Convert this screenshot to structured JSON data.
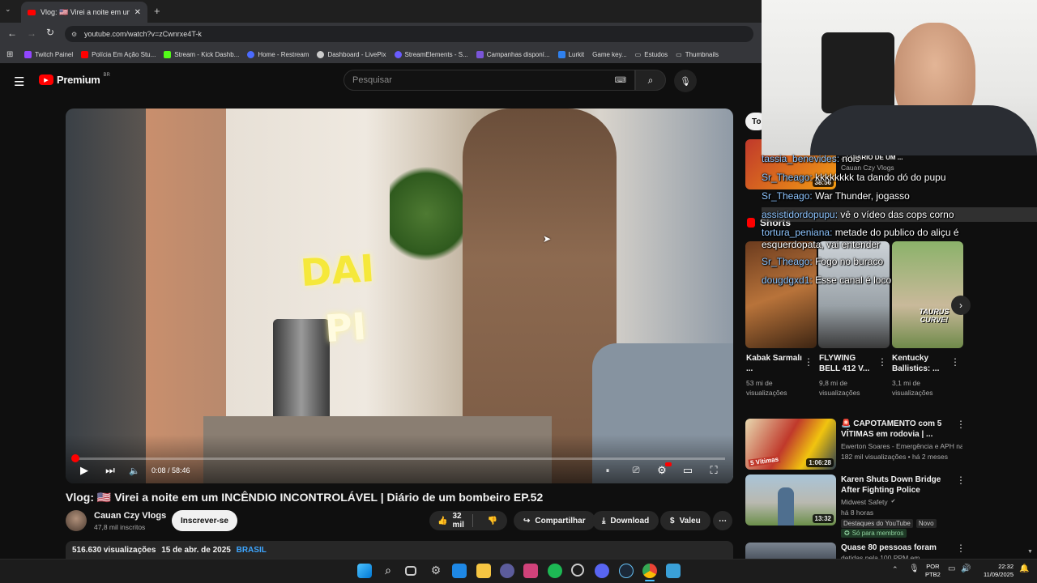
{
  "browser": {
    "tab_title": "Vlog: 🇺🇸 Virei a noite em um I",
    "url": "youtube.com/watch?v=zCwnrxe4T-k",
    "bookmarks": [
      "Twitch Painel",
      "Polícia Em Ação Stu...",
      "Stream - Kick Dashb...",
      "Home - Restream",
      "Dashboard - LivePix",
      "StreamElements - S...",
      "Campanhas disponí...",
      "Lurkit",
      "Game key...",
      "Estudos",
      "Thumbnails"
    ]
  },
  "youtube": {
    "logo": "Premium",
    "region": "BR",
    "search_placeholder": "Pesquisar"
  },
  "video": {
    "overlay_text": [
      "DAI",
      "PI"
    ],
    "time": "0:08 / 58:46",
    "progress_fraction": 0.0023,
    "title": "Vlog: 🇺🇸 Virei a noite em um INCÊNDIO INCONTROLÁVEL | Diário de um bombeiro EP.52",
    "channel": "Cauan Czy Vlogs",
    "subscribers": "47,8 mil inscritos",
    "subscribe_label": "Inscrever-se",
    "likes": "32 mil",
    "share_label": "Compartilhar",
    "download_label": "Download",
    "thanks_label": "Valeu",
    "views": "516.630 visualizações",
    "date": "15 de abr. de 2025",
    "tag": "BRASIL"
  },
  "chat": [
    {
      "user": "tassia_benevides:",
      "msg": "nois"
    },
    {
      "user": "Sr_Theago:",
      "msg": "kkkkkkkk ta dando dó do pupu"
    },
    {
      "user": "Sr_Theago:",
      "msg": "War Thunder, jogasso"
    },
    {
      "user": "assistidordopupu:",
      "msg": "vê o vídeo das cops corno"
    },
    {
      "user": "tortura_peniana:",
      "msg": "metade do publico do aliçu é"
    },
    {
      "user": "",
      "msg": "esquerdopata, vai entender"
    },
    {
      "user": "Sr_Theago:",
      "msg": "Fogo no buraco"
    },
    {
      "user": "dougdgxd1:",
      "msg": "Esse canal é loco"
    }
  ],
  "sidebar": {
    "chip": "To",
    "partial_title": "...: DIÁRIO DE UM ...",
    "partial_channel": "Cauan Czy Vlogs",
    "partial_duration": "38:56",
    "shorts_label": "Shorts",
    "shorts": [
      {
        "title": "Kabak Sarmalı ...",
        "views": "53 mi de visualizações"
      },
      {
        "title": "FLYWING BELL 412 V...",
        "views": "9,8 mi de visualizações"
      },
      {
        "title": "Kentucky Ballistics: ...",
        "views": "3,1 mi de visualizações",
        "thumb_text": "TAURUS CURVE!"
      }
    ],
    "videos": [
      {
        "title": "🚨 CAPOTAMENTO com 5 VÍTIMAS em rodovia | ...",
        "channel": "Ewerton Soares - Emergência e APH na ...",
        "meta": "182 mil visualizações • há 2 meses",
        "duration": "1:06:28",
        "thumb_text": "5 Vítimas"
      },
      {
        "title": "Karen Shuts Down Bridge After Fighting Police",
        "channel": "Midwest Safety",
        "meta": "há 8 horas",
        "badge1": "Destaques do YouTube",
        "badge2": "Novo",
        "members": "Só para membros",
        "duration": "13:32"
      },
      {
        "title": "Quase 80 pessoas foram",
        "meta": "detidas pela 100 PPM em"
      }
    ]
  },
  "taskbar": {
    "lang": "POR",
    "layout": "PTB2",
    "time": "22:32",
    "date": "11/09/2025"
  }
}
